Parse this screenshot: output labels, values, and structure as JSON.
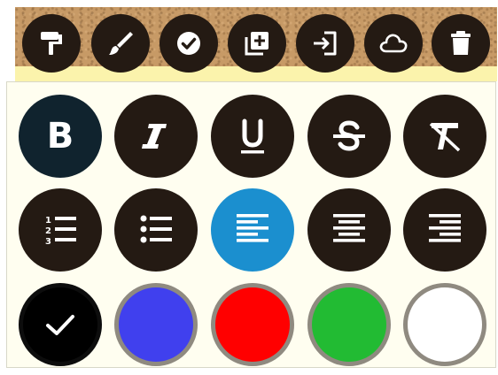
{
  "toolbar": {
    "items": [
      {
        "name": "format-painter",
        "icon": "paint-roller-icon"
      },
      {
        "name": "brush",
        "icon": "paintbrush-icon"
      },
      {
        "name": "done",
        "icon": "check-circle-icon"
      },
      {
        "name": "add-note",
        "icon": "add-copy-icon"
      },
      {
        "name": "import",
        "icon": "sign-in-icon"
      },
      {
        "name": "cloud-save",
        "icon": "cloud-icon"
      },
      {
        "name": "delete",
        "icon": "trash-icon"
      }
    ]
  },
  "format_panel": {
    "text_styles": [
      {
        "name": "bold",
        "label": "B",
        "icon": "bold-icon"
      },
      {
        "name": "italic",
        "icon": "italic-icon"
      },
      {
        "name": "underline",
        "icon": "underline-icon"
      },
      {
        "name": "strikethrough",
        "icon": "strikethrough-icon"
      },
      {
        "name": "clear-formatting",
        "icon": "clear-format-icon"
      }
    ],
    "lists_alignment": [
      {
        "name": "numbered-list",
        "icon": "numbered-list-icon",
        "number_labels": [
          "1",
          "2",
          "3"
        ]
      },
      {
        "name": "bulleted-list",
        "icon": "bulleted-list-icon"
      },
      {
        "name": "align-left",
        "icon": "align-left-icon",
        "active": true
      },
      {
        "name": "align-center",
        "icon": "align-center-icon"
      },
      {
        "name": "align-right",
        "icon": "align-right-icon"
      }
    ],
    "colors": [
      {
        "name": "black",
        "hex": "#000000",
        "selected": true
      },
      {
        "name": "blue",
        "hex": "#4040ee"
      },
      {
        "name": "red",
        "hex": "#ff0000"
      },
      {
        "name": "green",
        "hex": "#22bb33"
      },
      {
        "name": "white",
        "hex": "#ffffff"
      }
    ]
  },
  "theme": {
    "button_color": "#241a13",
    "bold_button_color": "#10232e",
    "active_color": "#1b8fcf",
    "swatch_ring_color": "#8f8a80",
    "panel_background": "#fffef0",
    "note_strip_color": "#fbf3ac",
    "cork_color": "#c79a66"
  }
}
